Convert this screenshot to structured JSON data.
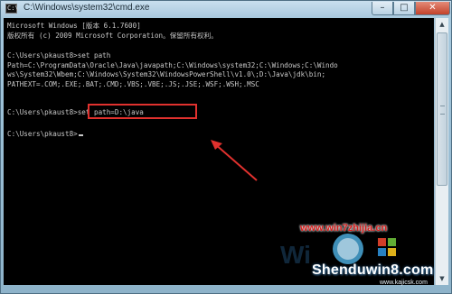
{
  "window": {
    "title": "C:\\Windows\\system32\\cmd.exe",
    "icon_label": "C:\\",
    "min_glyph": "–",
    "max_glyph": "□",
    "close_glyph": "✕"
  },
  "console": {
    "lines": [
      "Microsoft Windows [版本 6.1.7600]",
      "版权所有 (c) 2009 Microsoft Corporation。保留所有权利。",
      "",
      "C:\\Users\\pkaust8>set path",
      "Path=C:\\ProgramData\\Oracle\\Java\\javapath;C:\\Windows\\system32;C:\\Windows;C:\\Windo",
      "ws\\System32\\Wbem;C:\\Windows\\System32\\WindowsPowerShell\\v1.0\\;D:\\Java\\jdk\\bin;",
      "PATHEXT=.COM;.EXE;.BAT;.CMD;.VBS;.VBE;.JS;.JSE;.WSF;.WSH;.MSC",
      "",
      "C:\\Users\\pkaust8>set path=D:\\java",
      "",
      "C:\\Users\\pkaust8>"
    ],
    "text_color": "#c8c8c8",
    "background": "#000000"
  },
  "annotation": {
    "box_color": "#e0312e",
    "arrow_color": "#e0312e"
  },
  "scrollbar": {
    "up_glyph": "▲",
    "down_glyph": "▼"
  },
  "watermark": {
    "url": "www.win7zhijia.cn",
    "brand": "Shenduwin8.com",
    "small": "www.kajicsk.com"
  }
}
